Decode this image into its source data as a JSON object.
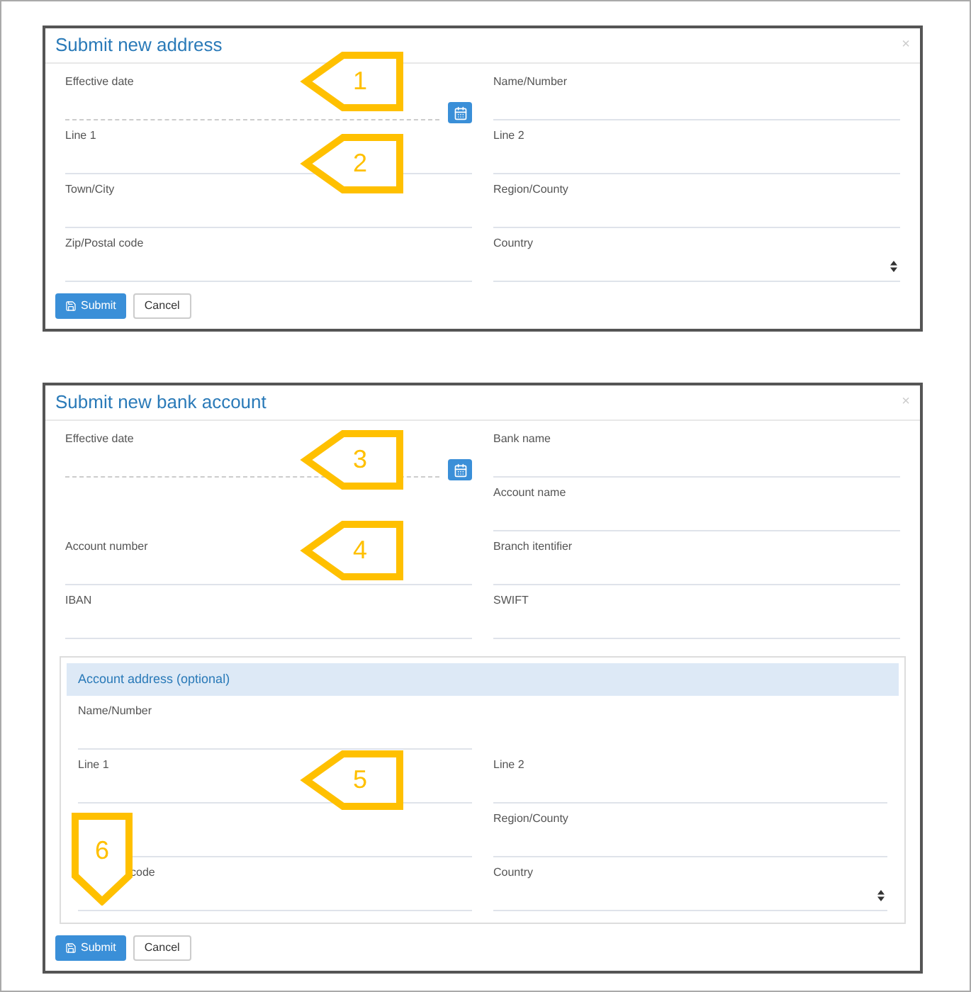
{
  "dialogs": [
    {
      "title": "Submit new address",
      "close": "×",
      "rows": [
        {
          "left": {
            "label": "Effective date",
            "kind": "date"
          },
          "right": {
            "label": "Name/Number",
            "kind": "text"
          }
        },
        {
          "left": {
            "label": "Line 1",
            "kind": "text"
          },
          "right": {
            "label": "Line 2",
            "kind": "text"
          }
        },
        {
          "left": {
            "label": "Town/City",
            "kind": "text"
          },
          "right": {
            "label": "Region/County",
            "kind": "text"
          }
        },
        {
          "left": {
            "label": "Zip/Postal code",
            "kind": "text"
          },
          "right": {
            "label": "Country",
            "kind": "select"
          }
        }
      ],
      "buttons": [
        {
          "label": "Submit",
          "kind": "primary"
        },
        {
          "label": "Cancel",
          "kind": "default"
        }
      ]
    },
    {
      "title": "Submit new bank account",
      "close": "×",
      "rows": [
        {
          "left": {
            "label": "Effective date",
            "kind": "date"
          },
          "right": {
            "label": "Bank name",
            "kind": "text"
          }
        },
        {
          "right": {
            "label": "Account name",
            "kind": "text"
          }
        },
        {
          "left": {
            "label": "Account number",
            "kind": "text"
          },
          "right": {
            "label": "Branch itentifier",
            "kind": "text"
          }
        },
        {
          "left": {
            "label": "IBAN",
            "kind": "text"
          },
          "right": {
            "label": "SWIFT",
            "kind": "text"
          }
        }
      ],
      "section": {
        "title": "Account address (optional)",
        "rows": [
          {
            "left": {
              "label": "Name/Number",
              "kind": "text"
            }
          },
          {
            "left": {
              "label": "Line 1",
              "kind": "text"
            },
            "right": {
              "label": "Line 2",
              "kind": "text"
            }
          },
          {
            "left": {
              "kind": "text"
            },
            "right": {
              "label": "Region/County",
              "kind": "text"
            }
          },
          {
            "left": {
              "label": "code",
              "kind": "text",
              "partly_covered": true
            },
            "right": {
              "label": "Country",
              "kind": "select"
            }
          }
        ]
      },
      "buttons": [
        {
          "label": "Submit",
          "kind": "primary"
        },
        {
          "label": "Cancel",
          "kind": "default"
        }
      ]
    }
  ],
  "callouts": [
    {
      "number": "1",
      "kind": "left"
    },
    {
      "number": "2",
      "kind": "left"
    },
    {
      "number": "3",
      "kind": "left"
    },
    {
      "number": "4",
      "kind": "left"
    },
    {
      "number": "5",
      "kind": "left"
    },
    {
      "number": "6",
      "kind": "down"
    }
  ]
}
